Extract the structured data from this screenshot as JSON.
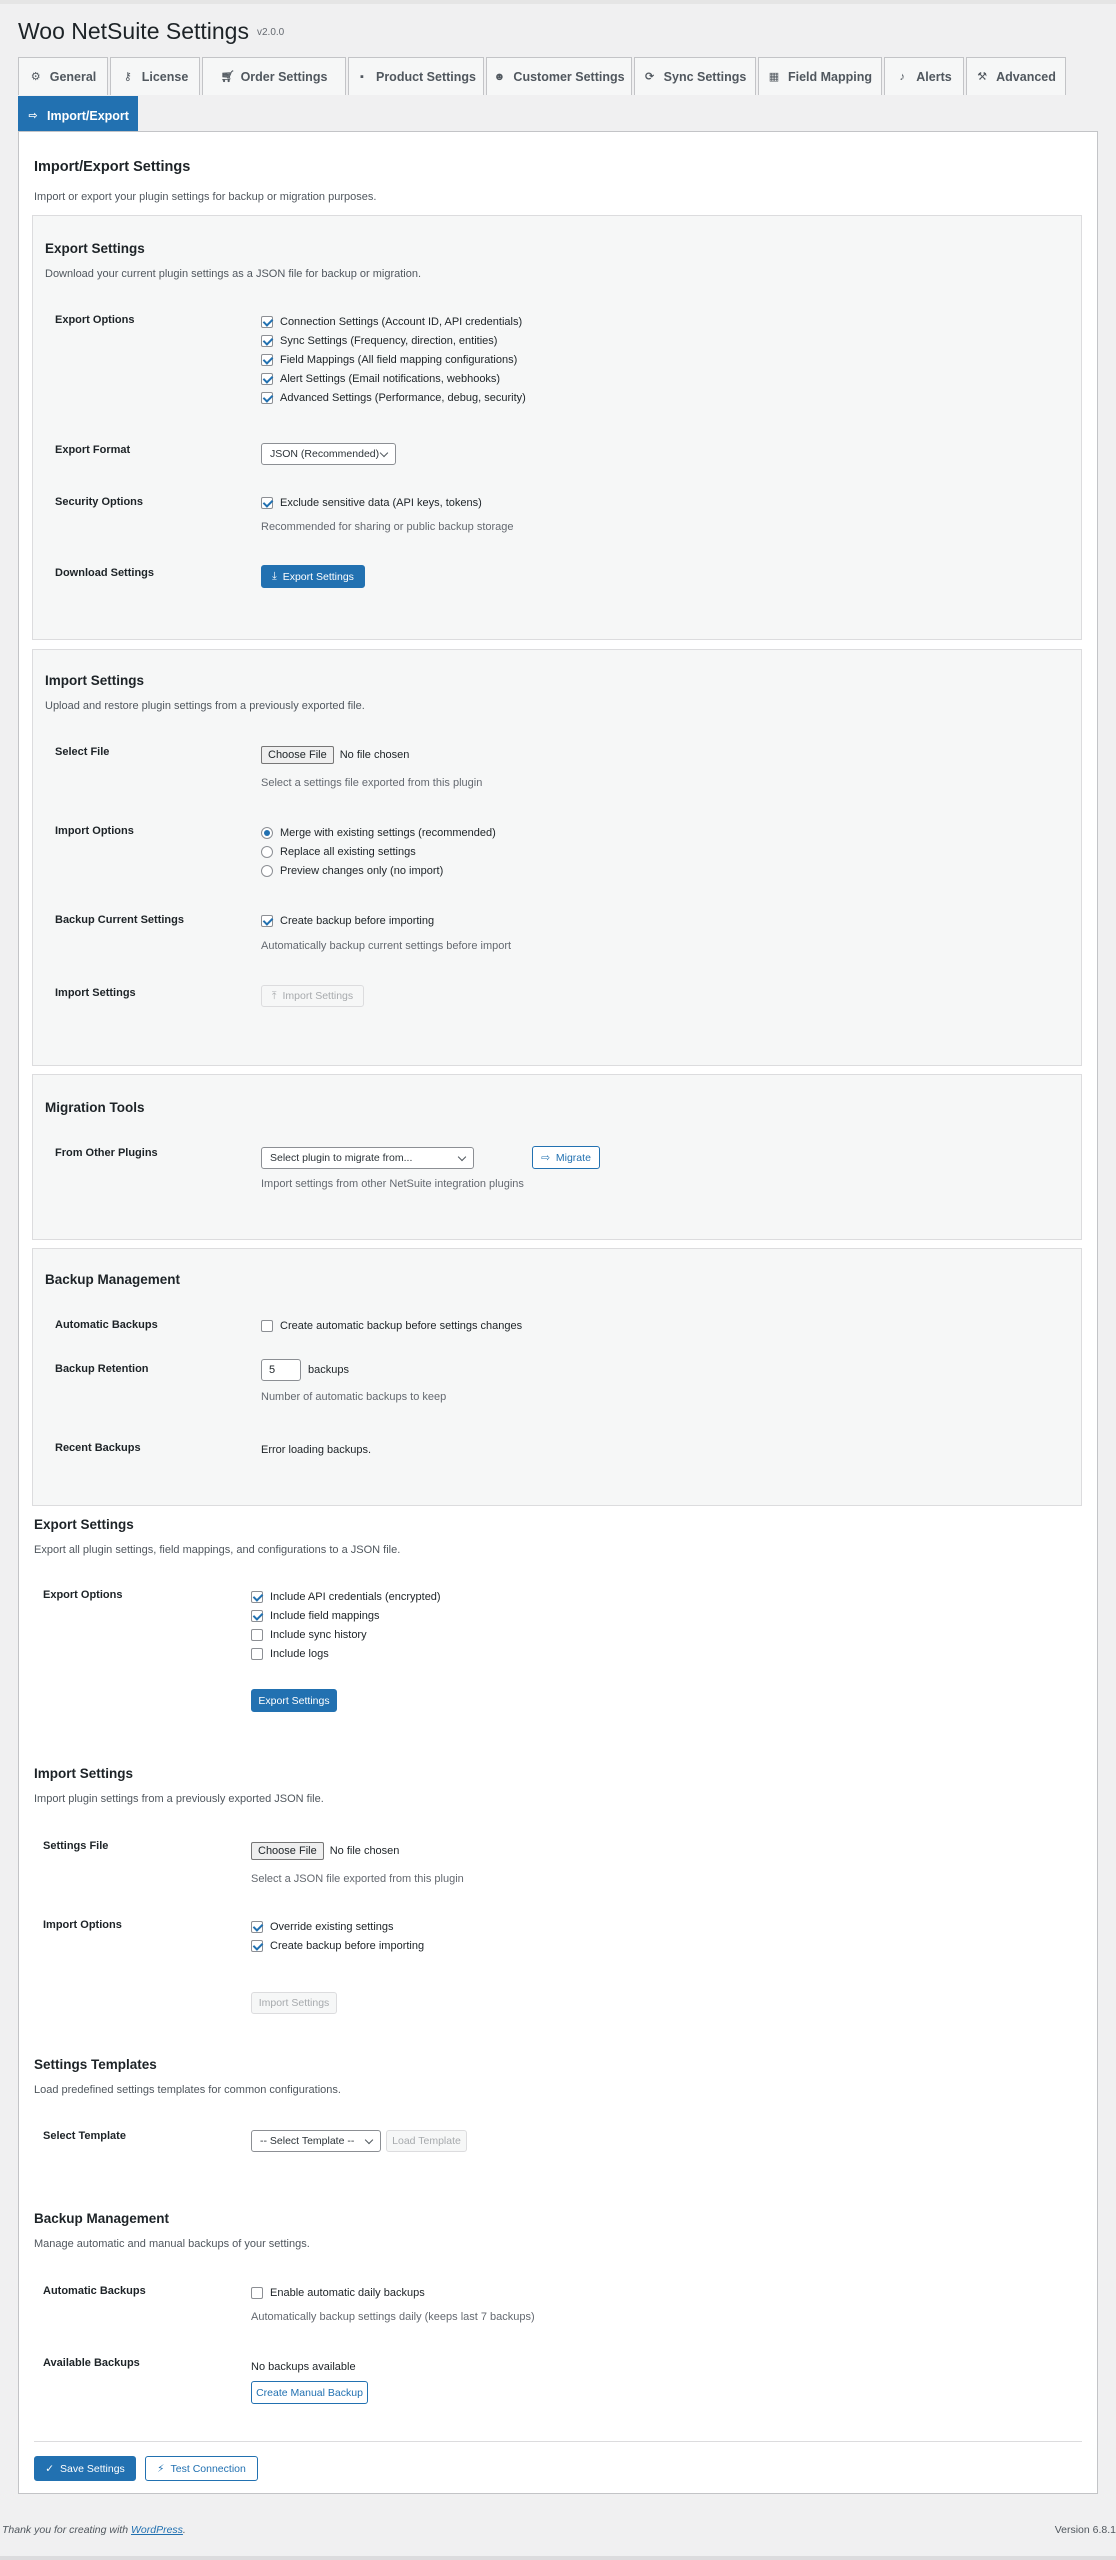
{
  "header": {
    "title": "Woo NetSuite Settings",
    "version": "v2.0.0"
  },
  "tabs": [
    {
      "label": "General",
      "icon": "gear-icon"
    },
    {
      "label": "License",
      "icon": "key-icon"
    },
    {
      "label": "Order Settings",
      "icon": "cart-icon"
    },
    {
      "label": "Product Settings",
      "icon": "box-icon"
    },
    {
      "label": "Customer Settings",
      "icon": "users-icon"
    },
    {
      "label": "Sync Settings",
      "icon": "sync-icon"
    },
    {
      "label": "Field Mapping",
      "icon": "table-icon"
    },
    {
      "label": "Alerts",
      "icon": "bell-icon"
    },
    {
      "label": "Advanced",
      "icon": "wrench-icon"
    },
    {
      "label": "Import/Export",
      "icon": "import-export-icon"
    }
  ],
  "colors": {
    "primary": "#2271b1",
    "box_bg": "#f6f7f7",
    "border": "#c3c4c7"
  },
  "panel": {
    "title": "Import/Export Settings",
    "description": "Import or export your plugin settings for backup or migration purposes."
  },
  "export_box": {
    "title": "Export Settings",
    "description": "Download your current plugin settings as a JSON file for backup or migration.",
    "options_label": "Export Options",
    "options": [
      {
        "label": "Connection Settings (Account ID, API credentials)",
        "checked": true
      },
      {
        "label": "Sync Settings (Frequency, direction, entities)",
        "checked": true
      },
      {
        "label": "Field Mappings (All field mapping configurations)",
        "checked": true
      },
      {
        "label": "Alert Settings (Email notifications, webhooks)",
        "checked": true
      },
      {
        "label": "Advanced Settings (Performance, debug, security)",
        "checked": true
      }
    ],
    "format_label": "Export Format",
    "format_value": "JSON (Recommended)",
    "security_label": "Security Options",
    "security_option": "Exclude sensitive data (API keys, tokens)",
    "security_help": "Recommended for sharing or public backup storage",
    "download_label": "Download Settings",
    "download_button": "Export Settings"
  },
  "import_box": {
    "title": "Import Settings",
    "description": "Upload and restore plugin settings from a previously exported file.",
    "file_label": "Select File",
    "file_button": "Choose File",
    "file_status": "No file chosen",
    "file_help": "Select a settings file exported from this plugin",
    "options_label": "Import Options",
    "options": [
      {
        "label": "Merge with existing settings (recommended)",
        "selected": true
      },
      {
        "label": "Replace all existing settings",
        "selected": false
      },
      {
        "label": "Preview changes only (no import)",
        "selected": false
      }
    ],
    "backup_label": "Backup Current Settings",
    "backup_option": "Create backup before importing",
    "backup_help": "Automatically backup current settings before import",
    "import_label": "Import Settings",
    "import_button": "Import Settings"
  },
  "migration_box": {
    "title": "Migration Tools",
    "from_label": "From Other Plugins",
    "select_placeholder": "Select plugin to migrate from...",
    "migrate_button": "Migrate",
    "help": "Import settings from other NetSuite integration plugins"
  },
  "backup_box": {
    "title": "Backup Management",
    "auto_label": "Automatic Backups",
    "auto_option": "Create automatic backup before settings changes",
    "retention_label": "Backup Retention",
    "retention_value": "5",
    "retention_unit": "backups",
    "retention_help": "Number of automatic backups to keep",
    "recent_label": "Recent Backups",
    "recent_value": "Error loading backups."
  },
  "export2": {
    "title": "Export Settings",
    "description": "Export all plugin settings, field mappings, and configurations to a JSON file.",
    "options_label": "Export Options",
    "options": [
      {
        "label": "Include API credentials (encrypted)",
        "checked": true
      },
      {
        "label": "Include field mappings",
        "checked": true
      },
      {
        "label": "Include sync history",
        "checked": false
      },
      {
        "label": "Include logs",
        "checked": false
      }
    ],
    "button": "Export Settings"
  },
  "import2": {
    "title": "Import Settings",
    "description": "Import plugin settings from a previously exported JSON file.",
    "file_label": "Settings File",
    "file_button": "Choose File",
    "file_status": "No file chosen",
    "file_help": "Select a JSON file exported from this plugin",
    "options_label": "Import Options",
    "options": [
      {
        "label": "Override existing settings",
        "checked": true
      },
      {
        "label": "Create backup before importing",
        "checked": true
      }
    ],
    "button": "Import Settings"
  },
  "templates": {
    "title": "Settings Templates",
    "description": "Load predefined settings templates for common configurations.",
    "select_label": "Select Template",
    "select_value": "-- Select Template --",
    "load_button": "Load Template"
  },
  "backup2": {
    "title": "Backup Management",
    "description": "Manage automatic and manual backups of your settings.",
    "auto_label": "Automatic Backups",
    "auto_option": "Enable automatic daily backups",
    "auto_help": "Automatically backup settings daily (keeps last 7 backups)",
    "available_label": "Available Backups",
    "available_value": "No backups available",
    "create_button": "Create Manual Backup"
  },
  "actions": {
    "save": "Save Settings",
    "test": "Test Connection"
  },
  "footer": {
    "thanks_prefix": "Thank you for creating with ",
    "wp_link": "WordPress",
    "thanks_suffix": ".",
    "version": "Version 6.8.1"
  }
}
